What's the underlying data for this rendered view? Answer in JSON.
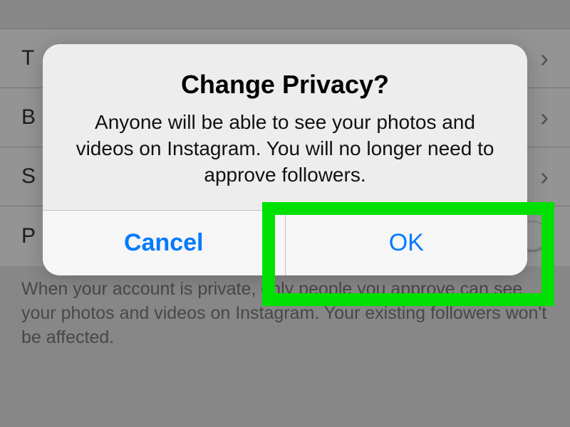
{
  "settings": {
    "rows": [
      {
        "label": "T",
        "type": "chevron"
      },
      {
        "label": "B",
        "type": "chevron"
      },
      {
        "label": "S",
        "type": "chevron"
      },
      {
        "label": "P",
        "type": "toggle"
      }
    ],
    "caption": "When your account is private, only people you approve can see your photos and videos on Instagram. Your existing followers won't be affected."
  },
  "alert": {
    "title": "Change Privacy?",
    "message": "Anyone will be able to see your photos and videos on Instagram. You will no longer need to approve followers.",
    "cancel_label": "Cancel",
    "ok_label": "OK"
  }
}
